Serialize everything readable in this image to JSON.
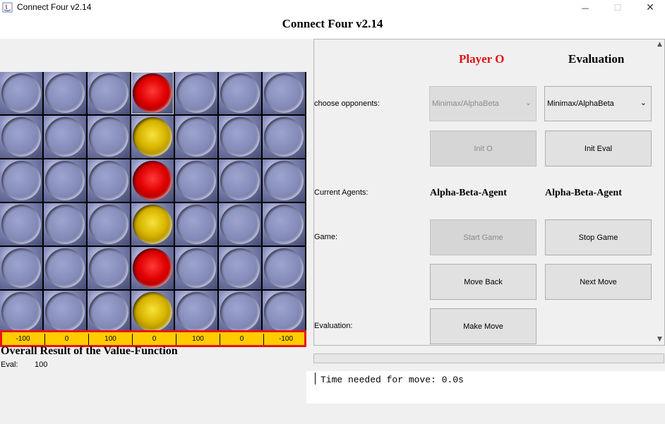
{
  "window": {
    "title": "Connect Four v2.14",
    "minimize": "—",
    "maximize": "☐",
    "close": "✕"
  },
  "header": {
    "title": "Connect Four v2.14"
  },
  "board": {
    "rows": [
      [
        "empty",
        "empty",
        "empty",
        "red",
        "empty",
        "empty",
        "empty"
      ],
      [
        "empty",
        "empty",
        "empty",
        "yellow",
        "empty",
        "empty",
        "empty"
      ],
      [
        "empty",
        "empty",
        "empty",
        "red",
        "empty",
        "empty",
        "empty"
      ],
      [
        "empty",
        "empty",
        "empty",
        "yellow",
        "empty",
        "empty",
        "empty"
      ],
      [
        "empty",
        "empty",
        "empty",
        "red",
        "empty",
        "empty",
        "empty"
      ],
      [
        "empty",
        "empty",
        "empty",
        "yellow",
        "empty",
        "empty",
        "empty"
      ]
    ],
    "column_values": [
      "-100",
      "0",
      "100",
      "0",
      "100",
      "0",
      "-100"
    ],
    "overall_label": "Overall Result of the Value-Function",
    "eval_key": "Eval:",
    "eval_value": "100"
  },
  "panel": {
    "player_o_header": "Player O",
    "evaluation_header": "Evaluation",
    "labels": {
      "choose_opponents": "choose opponents:",
      "current_agents": "Current Agents:",
      "game": "Game:",
      "evaluation": "Evaluation:"
    },
    "opponent_o": "Minimax/AlphaBeta",
    "opponent_eval": "Minimax/AlphaBeta",
    "agent_o": "Alpha-Beta-Agent",
    "agent_eval": "Alpha-Beta-Agent",
    "buttons": {
      "init_o": "Init O",
      "init_eval": "Init Eval",
      "start_game": "Start Game",
      "stop_game": "Stop Game",
      "move_back": "Move Back",
      "next_move": "Next Move",
      "make_move": "Make Move"
    },
    "scroll_up": "▲",
    "scroll_down": "▼"
  },
  "log": {
    "text": "Time needed for move: 0.0s"
  },
  "colors": {
    "player_o": "#e01010",
    "eval_bar": "#ffcc00",
    "eval_bar_border": "#ee1111",
    "red_piece": "#e00000",
    "yellow_piece": "#d8b400"
  }
}
